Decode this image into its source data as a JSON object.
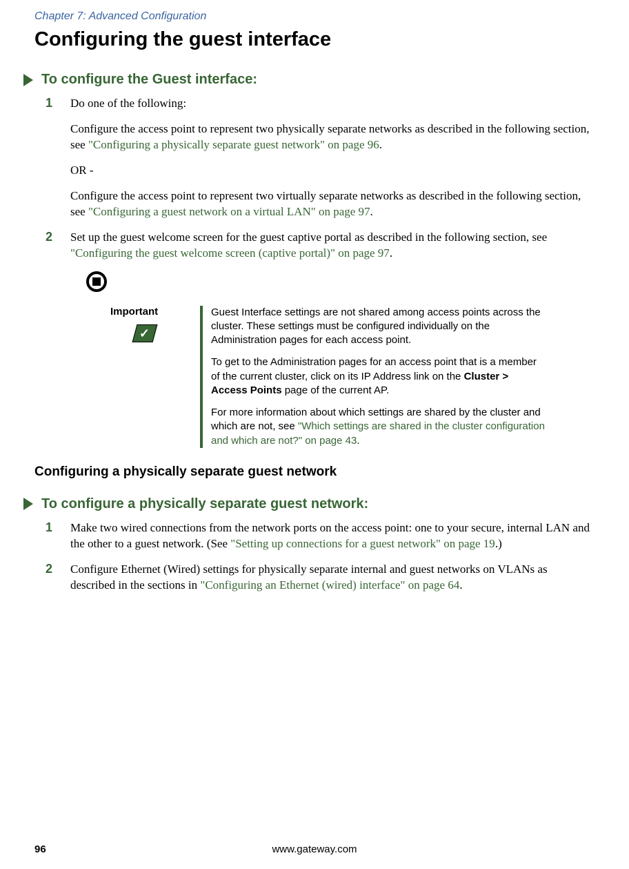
{
  "header": {
    "chapter": "Chapter 7: Advanced Configuration"
  },
  "main": {
    "heading": "Configuring the guest interface",
    "procedure1": {
      "title": "To configure the Guest interface:",
      "step1_num": "1",
      "step1_text": "Do one of the following:",
      "step1_body1_a": "Configure the access point to represent two physically separate networks as described in the following section, see ",
      "step1_body1_link": "\"Configuring a physically separate guest network\" on page 96",
      "step1_body1_b": ".",
      "or_text": "OR -",
      "step1_body2_a": "Configure the access point to represent two virtually separate networks as described in the following section, see ",
      "step1_body2_link": "\"Configuring a guest network on a virtual LAN\" on page 97",
      "step1_body2_b": ".",
      "step2_num": "2",
      "step2_text_a": "Set up the guest welcome screen for the guest captive portal as described in the following section, see ",
      "step2_link": "\"Configuring the guest welcome screen (captive portal)\" on page 97",
      "step2_text_b": "."
    },
    "important": {
      "label": "Important",
      "para1": "Guest Interface settings are not shared among access points across the cluster. These settings must be configured individually on the Administration pages for each access point.",
      "para2_a": "To get to the Administration pages for an access point that is a member of the current cluster, click on its IP Address link on the ",
      "para2_bold": "Cluster > Access Points",
      "para2_b": " page of the current AP.",
      "para3_a": "For more information about which settings are shared by the cluster and which are not, see ",
      "para3_link": "\"Which settings are shared in the cluster configuration and which are not?\" on page 43",
      "para3_b": "."
    },
    "subheading": "Configuring a physically separate guest network",
    "procedure2": {
      "title": "To configure a physically separate guest network:",
      "step1_num": "1",
      "step1_text_a": "Make two wired connections from the network ports on the access point: one to your secure, internal LAN and the other to a guest network. (See ",
      "step1_link": "\"Setting up connections for a guest network\" on page 19",
      "step1_text_b": ".)",
      "step2_num": "2",
      "step2_text_a": "Configure Ethernet (Wired) settings for physically separate internal and guest networks on VLANs as described in the sections in ",
      "step2_link": "\"Configuring an Ethernet (wired) interface\" on page 64",
      "step2_text_b": "."
    }
  },
  "footer": {
    "page": "96",
    "url": "www.gateway.com"
  }
}
